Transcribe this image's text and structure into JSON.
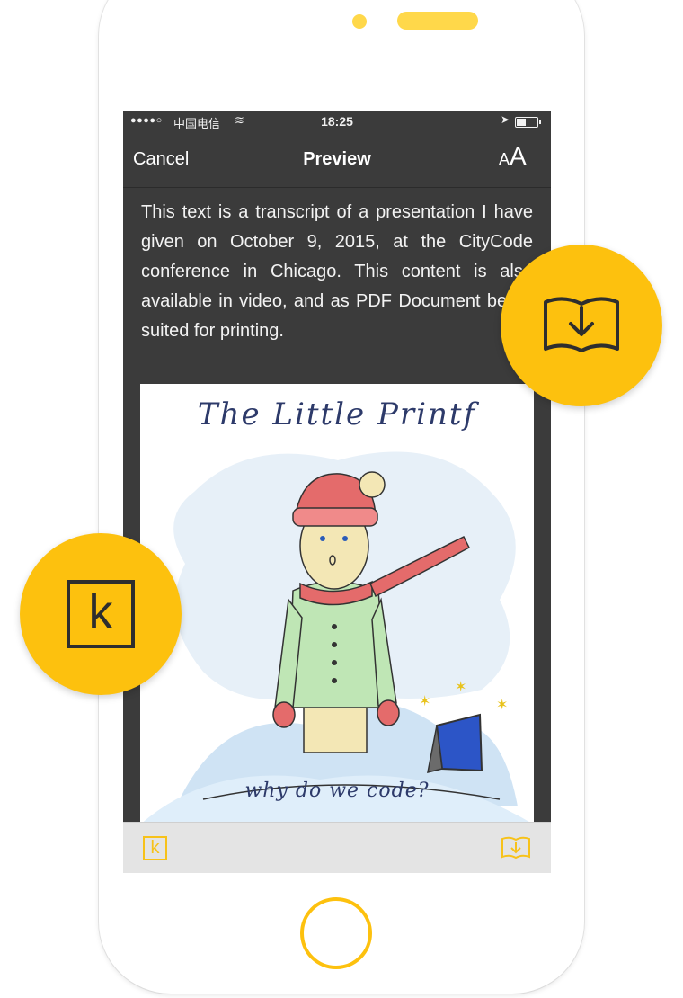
{
  "status_bar": {
    "signal": "●●●●○",
    "carrier": "中国电信",
    "wifi": "≋",
    "time": "18:25",
    "location_icon": "location-arrow-icon",
    "battery_icon": "battery-icon"
  },
  "nav": {
    "cancel_label": "Cancel",
    "title": "Preview",
    "font_size_small": "A",
    "font_size_large": "A"
  },
  "article": {
    "text": "This text is a transcript of a presentation I have given on October 9, 2015, at the CityCode conference in Chicago. This content is also available in video, and as PDF Document better suited for printing."
  },
  "illustration": {
    "title": "The Little Printf",
    "caption": "why do we code?"
  },
  "toolbar": {
    "kindle_label": "k",
    "book_icon": "book-download-icon"
  },
  "badges": {
    "kindle_label": "k",
    "book_icon": "book-download-icon"
  },
  "colors": {
    "accent": "#fdc10e",
    "screen_bg": "#3b3b3b",
    "toolbar_bg": "#e4e4e4"
  }
}
